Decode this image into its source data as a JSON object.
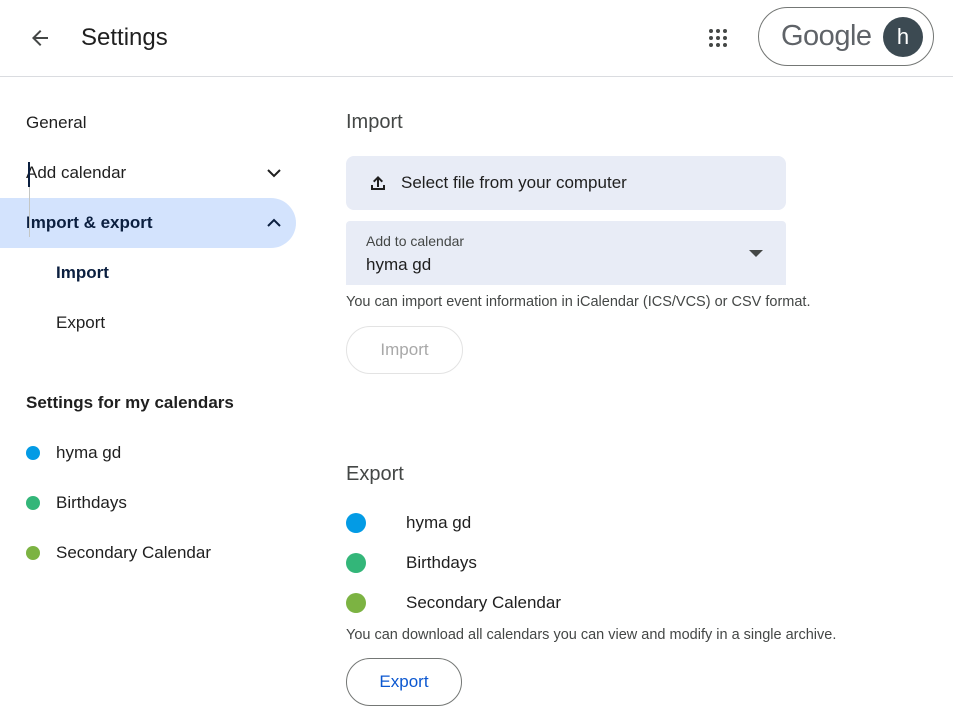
{
  "header": {
    "title": "Settings",
    "logo_text": "Google",
    "avatar_initial": "h"
  },
  "sidebar": {
    "items": [
      {
        "label": "General"
      },
      {
        "label": "Add calendar"
      },
      {
        "label": "Import & export"
      }
    ],
    "sub_items": [
      {
        "label": "Import"
      },
      {
        "label": "Export"
      }
    ],
    "my_calendars_heading": "Settings for my calendars",
    "calendars": [
      {
        "label": "hyma gd",
        "color": "#039be5"
      },
      {
        "label": "Birthdays",
        "color": "#33b679"
      },
      {
        "label": "Secondary Calendar",
        "color": "#7cb342"
      }
    ]
  },
  "import": {
    "heading": "Import",
    "select_file_label": "Select file from your computer",
    "add_to_calendar_label": "Add to calendar",
    "add_to_calendar_value": "hyma gd",
    "help_text": "You can import event information in iCalendar (ICS/VCS) or CSV format.",
    "button_label": "Import"
  },
  "export": {
    "heading": "Export",
    "calendars": [
      {
        "label": "hyma gd",
        "color": "#039be5"
      },
      {
        "label": "Birthdays",
        "color": "#33b679"
      },
      {
        "label": "Secondary Calendar",
        "color": "#7cb342"
      }
    ],
    "help_text": "You can download all calendars you can view and modify in a single archive.",
    "button_label": "Export"
  },
  "colors": {
    "accent": "#0b57d0",
    "active_nav_bg": "#d3e3fd",
    "field_bg": "#e8ecf6"
  }
}
